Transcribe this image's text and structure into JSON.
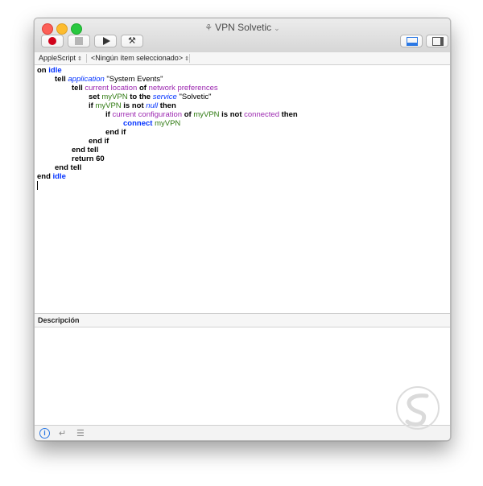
{
  "window": {
    "title": "VPN Solvetic"
  },
  "navbar": {
    "language": "AppleScript",
    "item_selector": "<Ningún ítem seleccionado>"
  },
  "script_lines": [
    {
      "t1": "on ",
      "t2": "idle"
    },
    {
      "t1": "tell ",
      "t2": "application",
      "t3": " \"System Events\""
    },
    {
      "t1": "tell ",
      "t2": "current location",
      "t3": " of ",
      "t4": "network preferences"
    },
    {
      "t1": "set ",
      "t2": "myVPN",
      "t3": " to the ",
      "t4": "service",
      "t5": " \"Solvetic\""
    },
    {
      "t1": "if ",
      "t2": "myVPN",
      "t3": " is not ",
      "t4": "null",
      "t5": " then"
    },
    {
      "t1": "if ",
      "t2": "current configuration",
      "t3": " of ",
      "t4": "myVPN",
      "t5": " is not ",
      "t6": "connected",
      "t7": " then"
    },
    {
      "t1": "connect ",
      "t2": "myVPN"
    },
    {
      "t1": "end if"
    },
    {
      "t1": "end if"
    },
    {
      "t1": "end tell"
    },
    {
      "t1": "return 60"
    },
    {
      "t1": "end tell"
    },
    {
      "t1": "end ",
      "t2": "idle"
    }
  ],
  "description": {
    "label": "Descripción"
  },
  "bottombar": {
    "info_icon": "i",
    "return_icon": "↵",
    "list_icon": "☰"
  },
  "colors": {
    "keyword_blue": "#0433ff",
    "property_purple": "#9c27b0",
    "variable_green": "#2f7a11",
    "record_red": "#d0021b"
  }
}
